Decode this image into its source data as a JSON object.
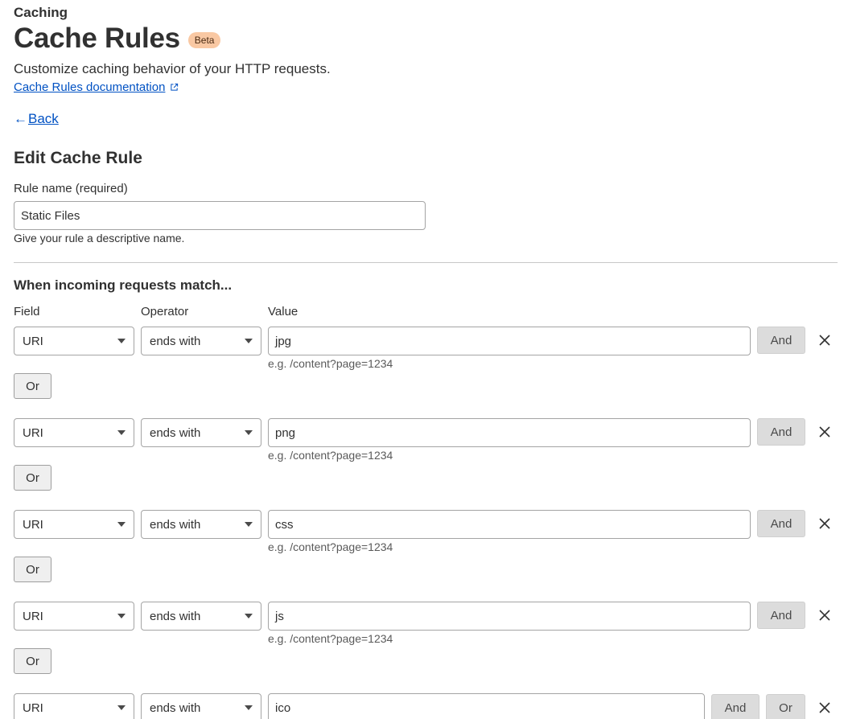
{
  "header": {
    "section": "Caching",
    "title": "Cache Rules",
    "badge": "Beta",
    "subtitle": "Customize caching behavior of your HTTP requests.",
    "doc_link": "Cache Rules documentation"
  },
  "nav": {
    "back_arrow": "←",
    "back_label": "Back"
  },
  "form": {
    "heading": "Edit Cache Rule",
    "rule_name_label": "Rule name (required)",
    "rule_name_value": "Static Files",
    "rule_name_help": "Give your rule a descriptive name."
  },
  "expression": {
    "heading": "When incoming requests match...",
    "columns": {
      "field": "Field",
      "operator": "Operator",
      "value": "Value"
    },
    "conditions": [
      {
        "field": "URI",
        "operator": "ends with",
        "value": "jpg",
        "example": "e.g. /content?page=1234",
        "and_label": "And",
        "or_label": "Or"
      },
      {
        "field": "URI",
        "operator": "ends with",
        "value": "png",
        "example": "e.g. /content?page=1234",
        "and_label": "And",
        "or_label": "Or"
      },
      {
        "field": "URI",
        "operator": "ends with",
        "value": "css",
        "example": "e.g. /content?page=1234",
        "and_label": "And",
        "or_label": "Or"
      },
      {
        "field": "URI",
        "operator": "ends with",
        "value": "js",
        "example": "e.g. /content?page=1234",
        "and_label": "And",
        "or_label": "Or"
      },
      {
        "field": "URI",
        "operator": "ends with",
        "value": "ico",
        "and_label": "And",
        "or_label": "Or"
      }
    ]
  },
  "icons": {
    "external_link": "external-link-icon",
    "dropdown": "chevron-down-icon",
    "remove": "close-icon"
  },
  "colors": {
    "link": "#0051c3",
    "badge_bg": "#f9c8a3",
    "button_gray": "#dcdcdc"
  }
}
